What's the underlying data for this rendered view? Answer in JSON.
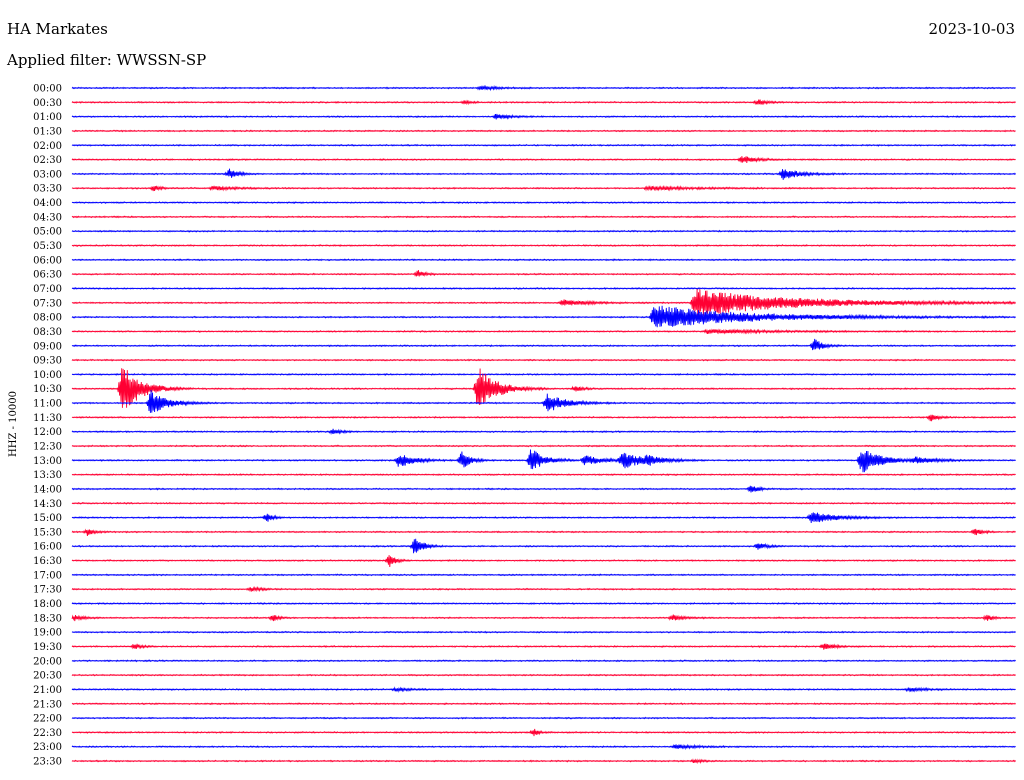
{
  "header": {
    "station": "HA Markates",
    "date": "2023-10-03",
    "filter": "Applied filter: WWSSN-SP"
  },
  "chart_data": {
    "type": "line",
    "title": "HA Markates",
    "subtitle": "Applied filter: WWSSN-SP",
    "ylabel": "HHZ - 10000",
    "colors": {
      "even": "#0000ff",
      "odd": "#ff0033"
    },
    "tick_labels": [
      "00:00",
      "00:30",
      "01:00",
      "01:30",
      "02:00",
      "02:30",
      "03:00",
      "03:30",
      "04:00",
      "04:30",
      "05:00",
      "05:30",
      "06:00",
      "06:30",
      "07:00",
      "07:30",
      "08:00",
      "08:30",
      "09:00",
      "09:30",
      "10:00",
      "10:30",
      "11:00",
      "11:30",
      "12:00",
      "12:30",
      "13:00",
      "13:30",
      "14:00",
      "14:30",
      "15:00",
      "15:30",
      "16:00",
      "16:30",
      "17:00",
      "17:30",
      "18:00",
      "18:30",
      "19:00",
      "19:30",
      "20:00",
      "20:30",
      "21:00",
      "21:30",
      "22:00",
      "22:30",
      "23:00",
      "23:30"
    ],
    "x_range_minutes": [
      0,
      30
    ],
    "events": [
      {
        "row": 0,
        "t": 13.0,
        "amp": 2,
        "dur": 0.8
      },
      {
        "row": 1,
        "t": 12.5,
        "amp": 2,
        "dur": 0.3
      },
      {
        "row": 1,
        "t": 21.8,
        "amp": 3,
        "dur": 0.4
      },
      {
        "row": 2,
        "t": 13.5,
        "amp": 3,
        "dur": 0.6
      },
      {
        "row": 5,
        "t": 21.3,
        "amp": 4,
        "dur": 0.6
      },
      {
        "row": 6,
        "t": 5.0,
        "amp": 5,
        "dur": 0.4
      },
      {
        "row": 6,
        "t": 22.6,
        "amp": 6,
        "dur": 0.8
      },
      {
        "row": 7,
        "t": 2.6,
        "amp": 3,
        "dur": 0.3
      },
      {
        "row": 7,
        "t": 4.5,
        "amp": 2,
        "dur": 1.0
      },
      {
        "row": 7,
        "t": 18.3,
        "amp": 2,
        "dur": 2.0
      },
      {
        "row": 13,
        "t": 11.0,
        "amp": 4,
        "dur": 0.3
      },
      {
        "row": 15,
        "t": 15.6,
        "amp": 3,
        "dur": 1.2
      },
      {
        "row": 15,
        "t": 19.8,
        "amp": 14,
        "dur": 4.8
      },
      {
        "row": 16,
        "t": 18.5,
        "amp": 12,
        "dur": 4.5
      },
      {
        "row": 17,
        "t": 20.2,
        "amp": 2,
        "dur": 3.0
      },
      {
        "row": 18,
        "t": 23.6,
        "amp": 7,
        "dur": 0.4
      },
      {
        "row": 21,
        "t": 1.6,
        "amp": 26,
        "dur": 0.9
      },
      {
        "row": 21,
        "t": 12.9,
        "amp": 24,
        "dur": 0.9
      },
      {
        "row": 21,
        "t": 16.0,
        "amp": 3,
        "dur": 0.4
      },
      {
        "row": 22,
        "t": 2.5,
        "amp": 13,
        "dur": 0.8
      },
      {
        "row": 22,
        "t": 15.1,
        "amp": 10,
        "dur": 0.9
      },
      {
        "row": 23,
        "t": 27.3,
        "amp": 4,
        "dur": 0.3
      },
      {
        "row": 24,
        "t": 8.3,
        "amp": 3,
        "dur": 0.4
      },
      {
        "row": 26,
        "t": 10.4,
        "amp": 8,
        "dur": 0.7
      },
      {
        "row": 26,
        "t": 12.4,
        "amp": 10,
        "dur": 0.4
      },
      {
        "row": 26,
        "t": 14.6,
        "amp": 13,
        "dur": 0.6
      },
      {
        "row": 26,
        "t": 16.3,
        "amp": 5,
        "dur": 0.9
      },
      {
        "row": 26,
        "t": 17.5,
        "amp": 8,
        "dur": 1.1
      },
      {
        "row": 26,
        "t": 18.3,
        "amp": 4,
        "dur": 0.6
      },
      {
        "row": 26,
        "t": 25.1,
        "amp": 14,
        "dur": 0.9
      },
      {
        "row": 26,
        "t": 26.8,
        "amp": 3,
        "dur": 1.1
      },
      {
        "row": 28,
        "t": 21.6,
        "amp": 5,
        "dur": 0.3
      },
      {
        "row": 30,
        "t": 6.2,
        "amp": 4,
        "dur": 0.3
      },
      {
        "row": 30,
        "t": 23.5,
        "amp": 6,
        "dur": 1.2
      },
      {
        "row": 31,
        "t": 0.5,
        "amp": 4,
        "dur": 0.3
      },
      {
        "row": 31,
        "t": 28.7,
        "amp": 4,
        "dur": 0.3
      },
      {
        "row": 32,
        "t": 10.9,
        "amp": 10,
        "dur": 0.4
      },
      {
        "row": 32,
        "t": 21.8,
        "amp": 3,
        "dur": 0.5
      },
      {
        "row": 33,
        "t": 10.1,
        "amp": 6,
        "dur": 0.3
      },
      {
        "row": 35,
        "t": 5.7,
        "amp": 2,
        "dur": 0.5
      },
      {
        "row": 37,
        "t": 0.1,
        "amp": 3,
        "dur": 0.4
      },
      {
        "row": 37,
        "t": 6.4,
        "amp": 3,
        "dur": 0.3
      },
      {
        "row": 37,
        "t": 19.1,
        "amp": 3,
        "dur": 0.5
      },
      {
        "row": 37,
        "t": 29.1,
        "amp": 3,
        "dur": 0.3
      },
      {
        "row": 39,
        "t": 2.0,
        "amp": 3,
        "dur": 0.3
      },
      {
        "row": 39,
        "t": 23.9,
        "amp": 4,
        "dur": 0.5
      },
      {
        "row": 42,
        "t": 10.3,
        "amp": 2,
        "dur": 0.6
      },
      {
        "row": 42,
        "t": 26.6,
        "amp": 2,
        "dur": 0.8
      },
      {
        "row": 45,
        "t": 14.7,
        "amp": 4,
        "dur": 0.2
      },
      {
        "row": 46,
        "t": 19.2,
        "amp": 2,
        "dur": 1.0
      },
      {
        "row": 47,
        "t": 19.8,
        "amp": 2,
        "dur": 0.3
      }
    ]
  }
}
